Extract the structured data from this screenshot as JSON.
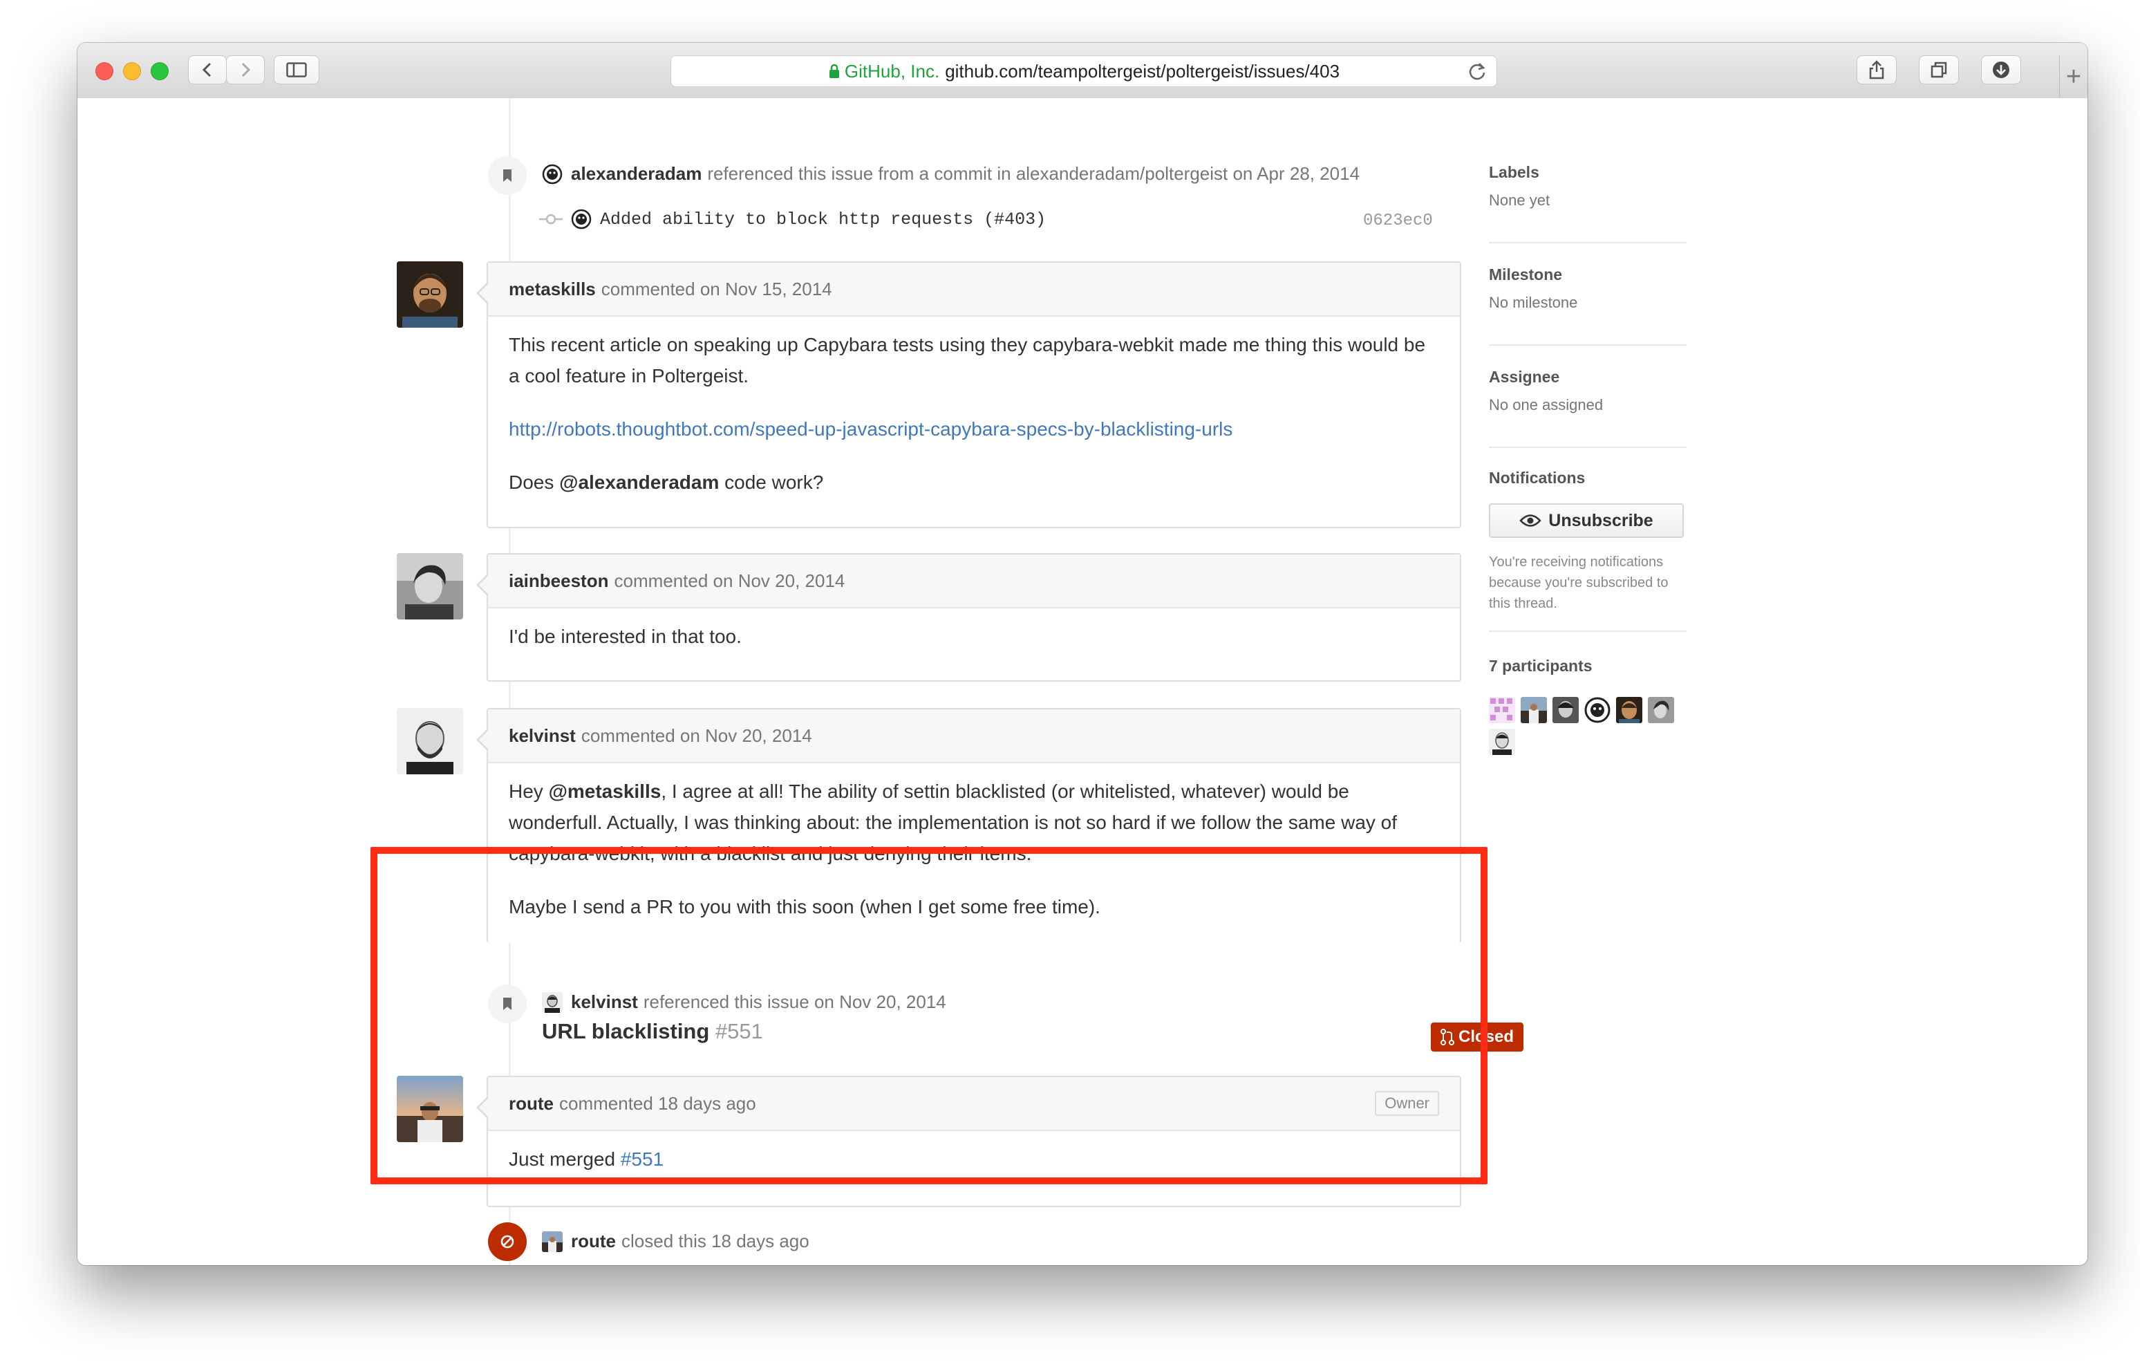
{
  "browser": {
    "secure_label": "GitHub, Inc.",
    "url_host": "github.com",
    "url_path": "/teampoltergeist/poltergeist/issues/403"
  },
  "timeline": {
    "reference1": {
      "user": "alexanderadam",
      "text": "referenced this issue from a commit in alexanderadam/poltergeist on Apr 28, 2014",
      "commit_message": "Added ability to block http requests (#403)",
      "commit_sha": "0623ec0"
    },
    "comment1": {
      "user": "metaskills",
      "meta": "commented on Nov 15, 2014",
      "p1": "This recent article on speaking up Capybara tests using they capybara-webkit made me thing this would be a cool feature in Poltergeist.",
      "link": "http://robots.thoughtbot.com/speed-up-javascript-capybara-specs-by-blacklisting-urls",
      "p3_pre": "Does ",
      "p3_mention": "@alexanderadam",
      "p3_post": " code work?"
    },
    "comment2": {
      "user": "iainbeeston",
      "meta": "commented on Nov 20, 2014",
      "body": "I'd be interested in that too."
    },
    "comment3": {
      "user": "kelvinst",
      "meta": "commented on Nov 20, 2014",
      "p1_pre": "Hey ",
      "p1_mention": "@metaskills",
      "p1_post": ", I agree at all! The ability of settin blacklisted (or whitelisted, whatever) would be wonderfull. Actually, I was thinking about: the implementation is not so hard if we follow the same way of capybara-webkit, with a blacklist and just denying their items.",
      "p2": "Maybe I send a PR to you with this soon (when I get some free time)."
    },
    "reference2": {
      "user": "kelvinst",
      "text": "referenced this issue on Nov 20, 2014",
      "pr_title": "URL blacklisting",
      "pr_number": "#551",
      "state": "Closed"
    },
    "comment4": {
      "user": "route",
      "meta": "commented 18 days ago",
      "badge": "Owner",
      "body_pre": "Just merged ",
      "body_link": "#551"
    },
    "close_event": {
      "user": "route",
      "text": "closed this 18 days ago"
    }
  },
  "sidebar": {
    "labels_title": "Labels",
    "labels_value": "None yet",
    "milestone_title": "Milestone",
    "milestone_value": "No milestone",
    "assignee_title": "Assignee",
    "assignee_value": "No one assigned",
    "notifications_title": "Notifications",
    "unsubscribe_label": "Unsubscribe",
    "notifications_note": "You're receiving notifications because you're subscribed to this thread.",
    "participants_title": "7 participants"
  },
  "colors": {
    "closed_red": "#bd2c00",
    "link_blue": "#4078c0",
    "highlight": "#ff2b12",
    "secure_green": "#1fa33b"
  }
}
